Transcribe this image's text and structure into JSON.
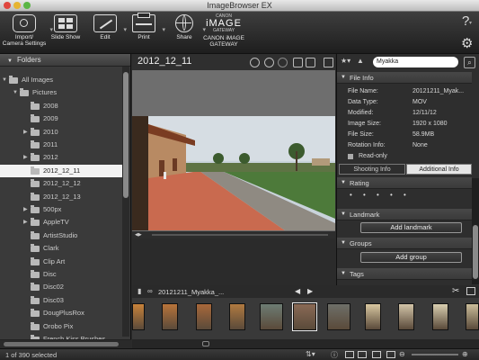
{
  "window": {
    "title": "ImageBrowser EX"
  },
  "toolbar": {
    "buttons": [
      {
        "label": "Import/\nCamera Settings",
        "icon": "camera-icon"
      },
      {
        "label": "Slide Show",
        "icon": "slideshow-icon"
      },
      {
        "label": "Edit",
        "icon": "edit-icon"
      },
      {
        "label": "Print",
        "icon": "printer-icon"
      },
      {
        "label": "Share",
        "icon": "globe-icon"
      },
      {
        "label": "CANON iMAGE\nGATEWAY",
        "icon": "canon-image-gateway-logo"
      }
    ],
    "logo": {
      "top": "CANON",
      "mid": "iMAGE",
      "bottom": "GATEWAY"
    },
    "help_label": "?",
    "settings_icon": "gear-icon"
  },
  "sidebar": {
    "header": "Folders",
    "items": [
      {
        "label": "All Images",
        "level": 0,
        "expanded": true
      },
      {
        "label": "Pictures",
        "level": 1,
        "expanded": true
      },
      {
        "label": "2008",
        "level": 2
      },
      {
        "label": "2009",
        "level": 2
      },
      {
        "label": "2010",
        "level": 2,
        "has_children": true
      },
      {
        "label": "2011",
        "level": 2
      },
      {
        "label": "2012",
        "level": 2,
        "has_children": true
      },
      {
        "label": "2012_12_11",
        "level": 2,
        "selected": true
      },
      {
        "label": "2012_12_12",
        "level": 2
      },
      {
        "label": "2012_12_13",
        "level": 2
      },
      {
        "label": "500px",
        "level": 2,
        "has_children": true
      },
      {
        "label": "AppleTV",
        "level": 2,
        "has_children": true
      },
      {
        "label": "ArtistStudio",
        "level": 2
      },
      {
        "label": "Clark",
        "level": 2
      },
      {
        "label": "Clip Art",
        "level": 2
      },
      {
        "label": "Disc",
        "level": 2
      },
      {
        "label": "Disc02",
        "level": 2
      },
      {
        "label": "Disc03",
        "level": 2
      },
      {
        "label": "DougPlusRox",
        "level": 2
      },
      {
        "label": "Orobo Pix",
        "level": 2
      },
      {
        "label": "French Kiss Brushes",
        "level": 2
      }
    ]
  },
  "main": {
    "folder_title": "2012_12_11",
    "search_value": "Myakka",
    "filmstrip_name": "20121211_Myakka_..."
  },
  "info": {
    "file_info_header": "File Info",
    "rows": [
      {
        "key": "File Name:",
        "value": "20121211_Myak..."
      },
      {
        "key": "Data Type:",
        "value": "MOV"
      },
      {
        "key": "Modified:",
        "value": "12/11/12"
      },
      {
        "key": "Image Size:",
        "value": "1920 x 1080"
      },
      {
        "key": "File Size:",
        "value": "58.9MB"
      },
      {
        "key": "Rotation Info:",
        "value": "None"
      }
    ],
    "read_only_label": "Read-only",
    "tabs": [
      "Shooting Info",
      "Additional Info"
    ],
    "active_tab": 1,
    "rating_header": "Rating",
    "rating_stars": 5,
    "rating_value": 0,
    "landmark_header": "Landmark",
    "add_landmark_label": "Add landmark",
    "groups_header": "Groups",
    "add_group_label": "Add group",
    "tags_header": "Tags"
  },
  "status": {
    "text": "1 of 390 selected"
  },
  "colors": {
    "selection": "#f2f2f2",
    "panel": "#2e2e2e",
    "toolbar": "#1e1e1e"
  }
}
